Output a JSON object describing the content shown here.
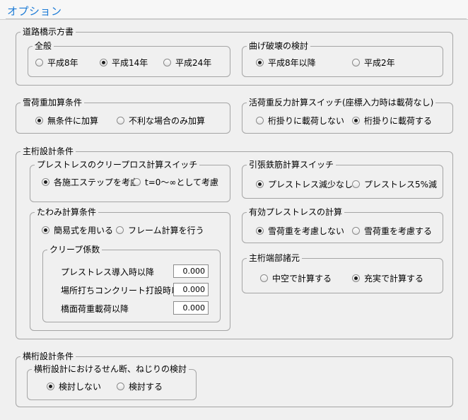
{
  "title": "オプション",
  "road_bridge": {
    "legend": "道路橋示方書",
    "general": {
      "legend": "全般",
      "options": [
        "平成8年",
        "平成14年",
        "平成24年"
      ]
    },
    "bending": {
      "legend": "曲げ破壊の検討",
      "options": [
        "平成8年以降",
        "平成2年"
      ]
    }
  },
  "snow_load": {
    "legend": "雪荷重加算条件",
    "options": [
      "無条件に加算",
      "不利な場合のみ加算"
    ]
  },
  "live_load": {
    "legend": "活荷重反力計算スイッチ(座標入力時は載荷なし)",
    "options": [
      "桁掛りに載荷しない",
      "桁掛りに載荷する"
    ]
  },
  "main_girder": {
    "legend": "主桁設計条件",
    "creep_switch": {
      "legend": "プレストレスのクリープロス計算スイッチ",
      "options": [
        "各施工ステップを考慮",
        "t=0～∞として考慮"
      ]
    },
    "deflection": {
      "legend": "たわみ計算条件",
      "options": [
        "簡易式を用いる",
        "フレーム計算を行う"
      ]
    },
    "creep_coef": {
      "legend": "クリープ係数",
      "rows": [
        {
          "label": "プレストレス導入時以降",
          "value": "0.000"
        },
        {
          "label": "場所打ちコンクリート打設時以降",
          "value": "0.000"
        },
        {
          "label": "橋面荷重載荷以降",
          "value": "0.000"
        }
      ]
    },
    "tension_rebar": {
      "legend": "引張鉄筋計算スイッチ",
      "options": [
        "プレストレス減少なし",
        "プレストレス5%減"
      ]
    },
    "effective_prestress": {
      "legend": "有効プレストレスの計算",
      "options": [
        "雪荷重を考慮しない",
        "雪荷重を考慮する"
      ]
    },
    "end_section": {
      "legend": "主桁端部諸元",
      "options": [
        "中空で計算する",
        "充実で計算する"
      ]
    }
  },
  "cross_girder": {
    "legend": "横桁設計条件",
    "shear_torsion": {
      "legend": "横桁設計におけるせん断、ねじりの検討",
      "options": [
        "検討しない",
        "検討する"
      ]
    }
  }
}
